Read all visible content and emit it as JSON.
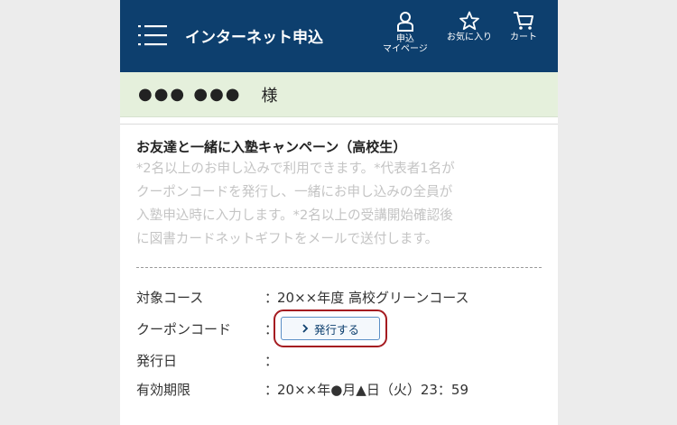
{
  "header": {
    "title": "インターネット申込",
    "mypage_label_1": "申込",
    "mypage_label_2": "マイページ",
    "favorites_label": "お気に入り",
    "cart_label": "カート",
    "bg_color": "#0d3f6e"
  },
  "user": {
    "name_masked": "●●● ●●●",
    "honorific": "様"
  },
  "campaign": {
    "title": "お友達と一緒に入塾キャンペーン（高校生）",
    "description_lines": [
      "*2名以上のお申し込みで利用できます。*代表者1名が",
      "クーポンコードを発行し、一緒にお申し込みの全員が",
      "入塾申込時に入力します。*2名以上の受講開始確認後",
      "に図書カードネットギフトをメールで送付します。"
    ]
  },
  "details": {
    "course_label": "対象コース",
    "course_value": "20××年度 高校グリーンコース",
    "coupon_label": "クーポンコード",
    "issue_button_label": "発行する",
    "issue_date_label": "発行日",
    "issue_date_value": "",
    "expiry_label": "有効期限",
    "expiry_value": "20××年●月▲日（火）23：59",
    "colon": "："
  }
}
